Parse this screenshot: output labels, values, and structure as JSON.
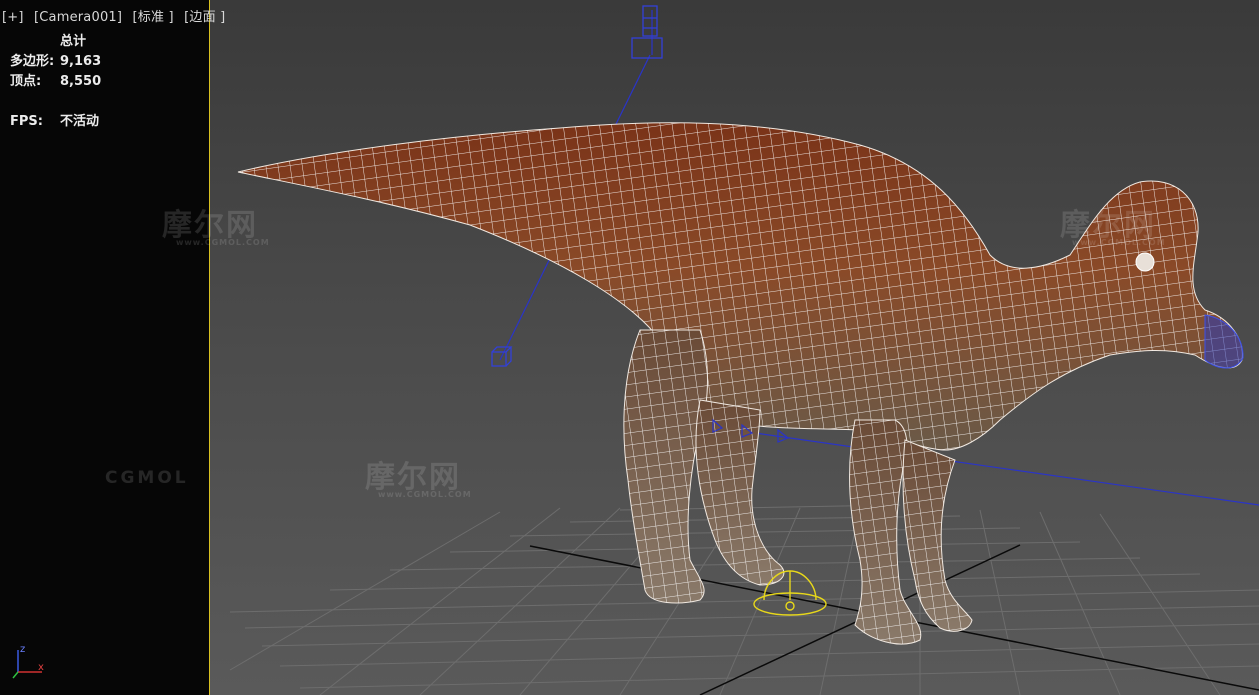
{
  "viewport": {
    "label_plus": "[+]",
    "label_camera": "[Camera001]",
    "label_shading": "[标准 ]",
    "label_mode": "[边面 ]"
  },
  "stats": {
    "header": "总计",
    "polys_label": "多边形:",
    "polys_value": "9,163",
    "verts_label": "顶点:",
    "verts_value": "8,550",
    "fps_label": "FPS:",
    "fps_value": "不活动"
  },
  "watermarks": {
    "brand_cn": "摩尔网",
    "brand_url": "www.CGMOL.COM",
    "brand_logo": "CGMOL"
  },
  "axis": {
    "z": "z",
    "x": "x"
  },
  "colors": {
    "viewport_border_active": "#d8c020",
    "wire": "#ffffff",
    "body": "#8a4424",
    "selection_helper": "#2a34c8",
    "light_gizmo": "#e8d81a"
  },
  "icons": [
    "bone-helper-box-icon",
    "light-gizmo-icon",
    "axis-tripod-icon"
  ]
}
